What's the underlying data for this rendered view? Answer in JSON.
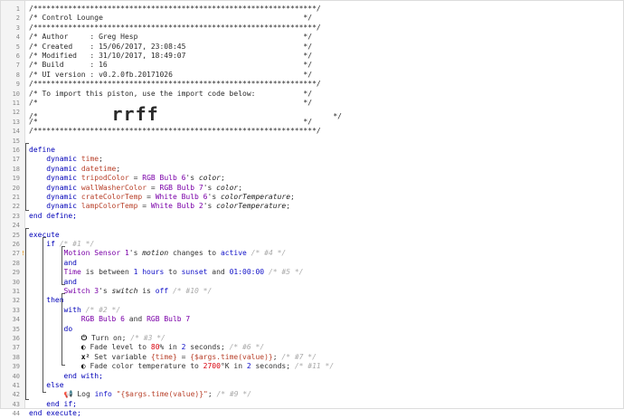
{
  "editor": {
    "lines": [
      {
        "n": "1",
        "text": "/*****************************************************************/"
      },
      {
        "n": "2",
        "text": "/* Control Lounge                                              */"
      },
      {
        "n": "3",
        "text": "/*****************************************************************/"
      },
      {
        "n": "4",
        "text": "/* Author     : Greg Hesp                                      */"
      },
      {
        "n": "5",
        "text": "/* Created    : 15/06/2017, 23:08:45                           */"
      },
      {
        "n": "6",
        "text": "/* Modified   : 31/10/2017, 18:49:07                           */"
      },
      {
        "n": "7",
        "text": "/* Build      : 16                                             */"
      },
      {
        "n": "8",
        "text": "/* UI version : v0.2.0fb.20171026                              */"
      },
      {
        "n": "9",
        "text": "/*****************************************************************/"
      },
      {
        "n": "10",
        "text": "/* To import this piston, use the import code below:           */"
      },
      {
        "n": "11",
        "text": "/*                                                             */"
      },
      {
        "n": "12",
        "text": "/*                 rrff                                        */"
      },
      {
        "n": "13",
        "text": "/*                                                             */"
      },
      {
        "n": "14",
        "text": "/*****************************************************************/"
      },
      {
        "n": "15",
        "text": ""
      },
      {
        "n": "16",
        "text": "define"
      },
      {
        "n": "17",
        "text": "    dynamic time;"
      },
      {
        "n": "18",
        "text": "    dynamic datetime;"
      },
      {
        "n": "19",
        "text": "    dynamic tripodColor = RGB Bulb 6's color;"
      },
      {
        "n": "20",
        "text": "    dynamic wallWasherColor = RGB Bulb 7's color;"
      },
      {
        "n": "21",
        "text": "    dynamic crateColorTemp = White Bulb 6's colorTemperature;"
      },
      {
        "n": "22",
        "text": "    dynamic lampColorTemp = White Bulb 2's colorTemperature;"
      },
      {
        "n": "23",
        "text": "end define;"
      },
      {
        "n": "24",
        "text": ""
      },
      {
        "n": "25",
        "text": "execute"
      },
      {
        "n": "26",
        "text": "    if /* #1 */"
      },
      {
        "n": "27",
        "text": "        Motion Sensor 1's motion changes to active /* #4 */"
      },
      {
        "n": "28",
        "text": "        and"
      },
      {
        "n": "29",
        "text": "        Time is between 1 hours to sunset and 01:00:00 /* #5 */"
      },
      {
        "n": "30",
        "text": "        and"
      },
      {
        "n": "31",
        "text": "        Switch 3's switch is off /* #10 */"
      },
      {
        "n": "32",
        "text": "    then"
      },
      {
        "n": "33",
        "text": "        with /* #2 */"
      },
      {
        "n": "34",
        "text": "            RGB Bulb 6 and RGB Bulb 7"
      },
      {
        "n": "35",
        "text": "        do"
      },
      {
        "n": "36",
        "text": "            Turn on; /* #3 */"
      },
      {
        "n": "37",
        "text": "            Fade level to 80% in 2 seconds; /* #6 */"
      },
      {
        "n": "38",
        "text": "            Set variable {time} = {$args.time(value)}; /* #7 */"
      },
      {
        "n": "39",
        "text": "            Fade color temperature to 2700°K in 2 seconds; /* #11 */"
      },
      {
        "n": "40",
        "text": "        end with;"
      },
      {
        "n": "41",
        "text": "    else"
      },
      {
        "n": "42",
        "text": "        Log info \"{$args.time(value)}\"; /* #9 */"
      },
      {
        "n": "43",
        "text": "    end if;"
      },
      {
        "n": "44",
        "text": "end execute;"
      }
    ],
    "header": {
      "title": "Control Lounge",
      "author": "Greg Hesp",
      "created": "15/06/2017, 23:08:45",
      "modified": "31/10/2017, 18:49:07",
      "build": "16",
      "ui_version": "v0.2.0fb.20171026",
      "import_note": "To import this piston, use the import code below:",
      "import_code": "rrff"
    },
    "breakpoint_marker": "!",
    "icons": {
      "power": "power-icon",
      "fade": "half-circle-icon",
      "variable": "x-squared-icon",
      "log": "megaphone-icon"
    },
    "colors": {
      "keyword": "#0000b8",
      "variable": "#b8402a",
      "device": "#7a00a8",
      "value": "#1010c8",
      "comment": "#aaaaaa",
      "marker": "#e8a33a"
    }
  }
}
